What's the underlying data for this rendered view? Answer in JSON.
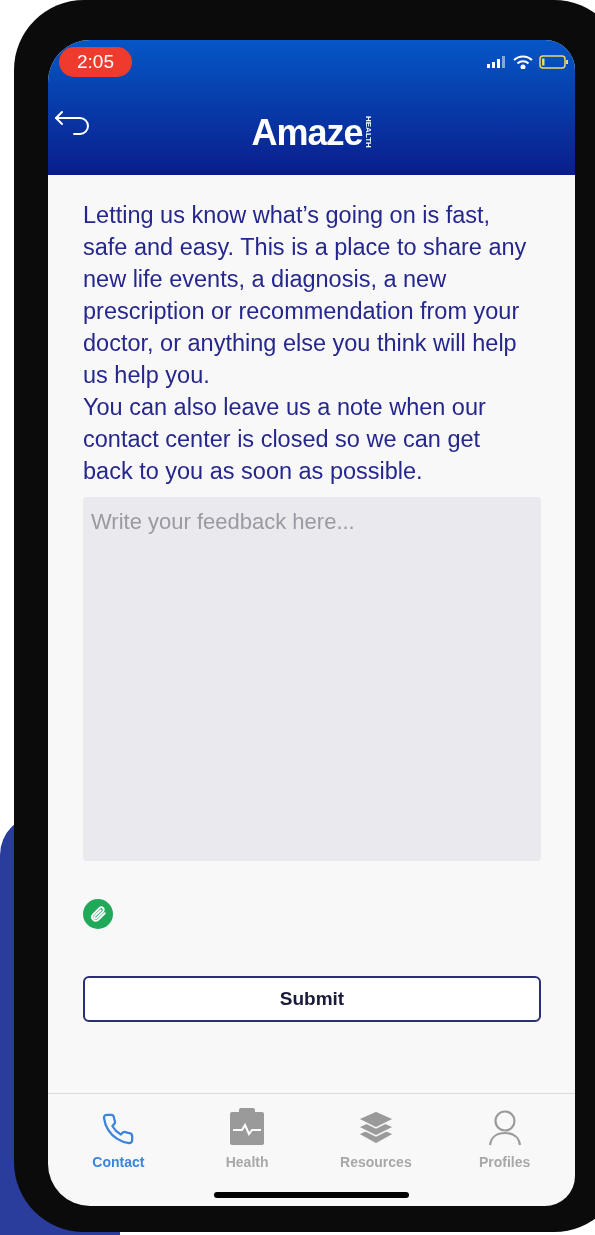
{
  "status_bar": {
    "time": "2:05"
  },
  "header": {
    "logo": {
      "name": "Amaze",
      "tagline": "HEALTH"
    }
  },
  "intro": [
    "Letting us know what’s going on is fast, safe and easy. This is a place to share any new life events, a diagnosis, a new prescription or recommendation from your doctor, or anything else you think will help us help you.",
    "You can also leave us a note when our contact center is closed so we can get back to you as soon as possible."
  ],
  "feedback": {
    "placeholder": "Write your feedback here..."
  },
  "submit": {
    "label": "Submit"
  },
  "tabs": [
    {
      "label": "Contact",
      "selected": true
    },
    {
      "label": "Health",
      "selected": false
    },
    {
      "label": "Resources",
      "selected": false
    },
    {
      "label": "Profiles",
      "selected": false
    }
  ]
}
